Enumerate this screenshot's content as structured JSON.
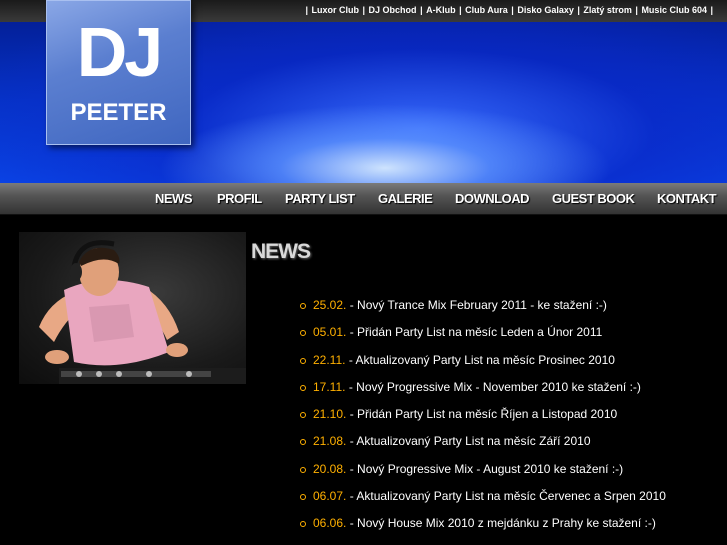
{
  "header": {
    "clubs": [
      "Luxor Club",
      "DJ Obchod",
      "A-Klub",
      "Club Aura",
      "Disko Galaxy",
      "Zlatý strom",
      "Music Club 604"
    ],
    "logo": {
      "line1": "DJ",
      "line2": "PEETER"
    }
  },
  "nav": [
    "NEWS",
    "PROFIL",
    "PARTY LIST",
    "GALERIE",
    "DOWNLOAD",
    "GUEST BOOK",
    "KONTAKT"
  ],
  "news": {
    "title": "NEWS",
    "items": [
      {
        "date": "25.02.",
        "text": "- Nový Trance Mix February 2011 - ke stažení :-)"
      },
      {
        "date": "05.01.",
        "text": "- Přidán Party List na měsíc Leden a Únor 2011"
      },
      {
        "date": "22.11.",
        "text": "- Aktualizovaný Party List na měsíc Prosinec 2010"
      },
      {
        "date": "17.11.",
        "text": "- Nový Progressive Mix - November 2010 ke stažení :-)"
      },
      {
        "date": "21.10.",
        "text": "- Přidán Party List na měsíc Říjen a Listopad 2010"
      },
      {
        "date": "21.08.",
        "text": "- Aktualizovaný Party List na měsíc Září 2010"
      },
      {
        "date": "20.08.",
        "text": "- Nový Progressive Mix - August 2010 ke stažení :-)"
      },
      {
        "date": "06.07.",
        "text": "- Aktualizovaný Party List na měsíc Červenec a Srpen 2010"
      },
      {
        "date": "06.06.",
        "text": "- Nový House Mix 2010 z mejdánku z Prahy ke stažení :-)"
      }
    ]
  },
  "colors": {
    "accent": "#ffb000",
    "header_blue": "#0633c8",
    "background": "#000000"
  }
}
